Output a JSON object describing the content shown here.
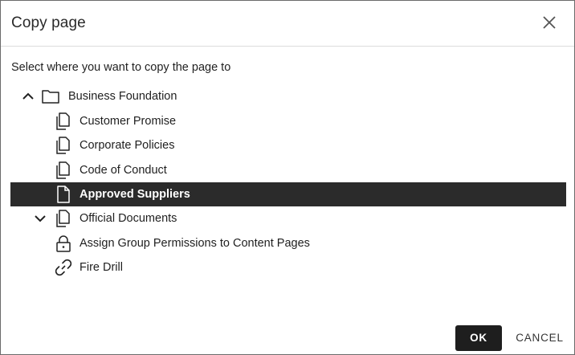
{
  "dialog": {
    "title": "Copy page",
    "instruction": "Select where you want to copy the page to",
    "close_icon": "close-icon"
  },
  "tree": {
    "items": [
      {
        "label": "Business Foundation",
        "icon": "folder-icon",
        "expanded": true,
        "selected": false
      },
      {
        "label": "Customer Promise",
        "icon": "pages-icon",
        "selected": false
      },
      {
        "label": "Corporate Policies",
        "icon": "pages-icon",
        "selected": false
      },
      {
        "label": "Code of Conduct",
        "icon": "pages-icon",
        "selected": false
      },
      {
        "label": "Approved Suppliers",
        "icon": "page-icon",
        "selected": true
      },
      {
        "label": "Official Documents",
        "icon": "pages-icon",
        "expanded": true,
        "selected": false
      },
      {
        "label": "Assign Group Permissions to Content Pages",
        "icon": "lock-icon",
        "selected": false
      },
      {
        "label": "Fire Drill",
        "icon": "link-icon",
        "selected": false
      }
    ]
  },
  "buttons": {
    "ok_label": "OK",
    "cancel_label": "CANCEL"
  },
  "colors": {
    "selected_bg": "#2b2b2b",
    "primary_button": "#1e1e1e"
  }
}
